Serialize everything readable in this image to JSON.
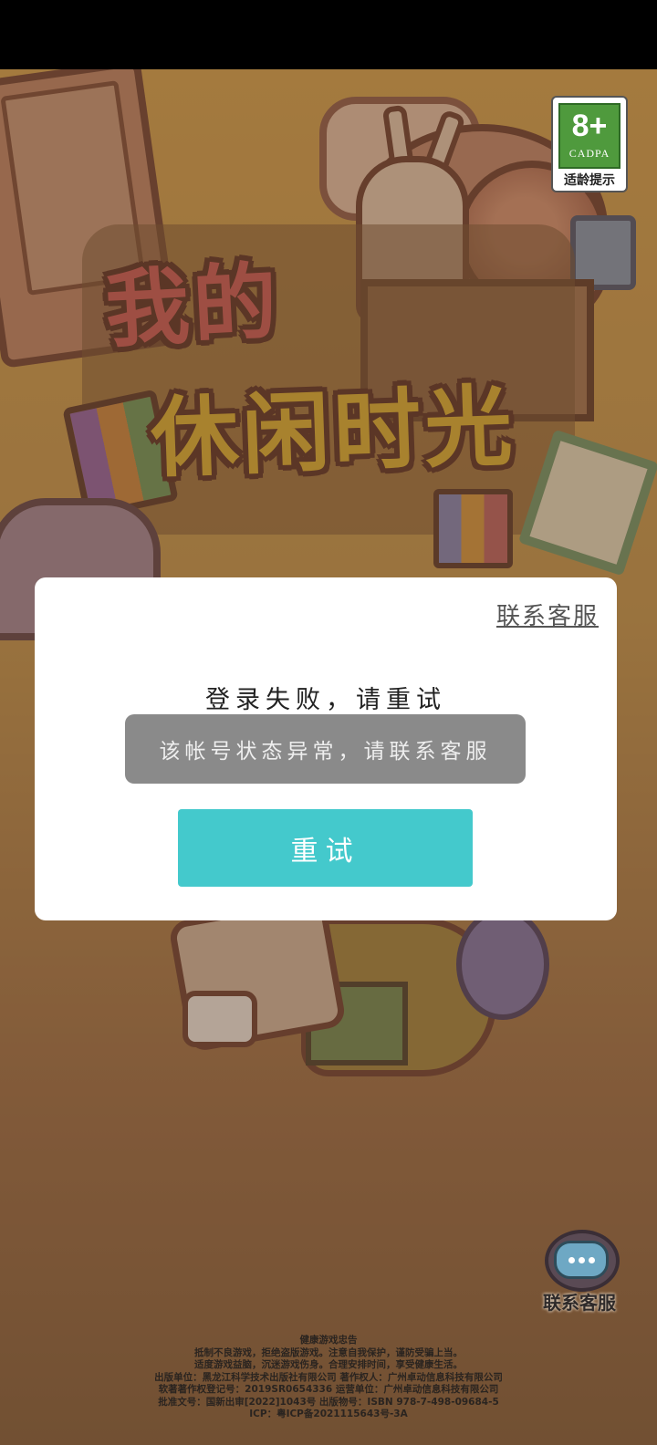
{
  "game": {
    "title_line1": "我的",
    "title_line2": "休闲时光"
  },
  "age_rating": {
    "number": "8+",
    "org": "CADPA",
    "tip": "适龄提示"
  },
  "dialog": {
    "contact_link": "联系客服",
    "title": "登录失败，请重试",
    "message": "该帐号状态异常，请联系客服",
    "retry_label": "重试"
  },
  "support": {
    "label": "联系客服",
    "icon": "headset-chat-icon"
  },
  "footer": {
    "lines": [
      "健康游戏忠告",
      "抵制不良游戏，拒绝盗版游戏。注意自我保护，谨防受骗上当。",
      "适度游戏益脑，沉迷游戏伤身。合理安排时间，享受健康生活。",
      "出版单位：黑龙江科学技术出版社有限公司   著作权人：广州卓动信息科技有限公司",
      "软著著作权登记号：2019SR0654336   运营单位：广州卓动信息科技有限公司",
      "批准文号：国新出审[2022]1043号   出版物号：ISBN 978-7-498-09684-5",
      "ICP：粤ICP备2021115643号-3A"
    ]
  },
  "colors": {
    "accent": "#44c9cc",
    "error_box": "#8a8a8a",
    "age_green": "#4f9a3d"
  }
}
